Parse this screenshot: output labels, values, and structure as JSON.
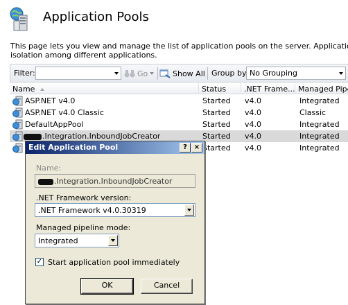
{
  "header": {
    "title": "Application Pools",
    "description_line1": "This page lets you view and manage the list of application pools on the server. Application pools are a",
    "description_line2": "isolation among different applications."
  },
  "toolbar": {
    "filter_label": "Filter:",
    "filter_value": "",
    "go_label": "Go",
    "show_all_label": "Show All",
    "group_by_label": "Group by:",
    "group_by_value": "No Grouping"
  },
  "list": {
    "columns": [
      "Name",
      "Status",
      ".NET Frame...",
      "Managed Pipel"
    ],
    "rows": [
      {
        "name": "ASP.NET v4.0",
        "status": "Started",
        "framework": "v4.0",
        "pipeline": "Integrated"
      },
      {
        "name": "ASP.NET v4.0 Classic",
        "status": "Started",
        "framework": "v4.0",
        "pipeline": "Classic"
      },
      {
        "name": "DefaultAppPool",
        "status": "Started",
        "framework": "v4.0",
        "pipeline": "Integrated"
      },
      {
        "name": ".Integration.InboundJobCreator",
        "status": "Started",
        "framework": "v4.0",
        "pipeline": "Integrated",
        "selected": true
      },
      {
        "name": "",
        "status": "Started",
        "framework": "v4.0",
        "pipeline": "Integrated"
      }
    ]
  },
  "dialog": {
    "title": "Edit Application Pool",
    "help_label": "?",
    "close_label": "×",
    "name_label": "Name:",
    "name_value": ".Integration.InboundJobCreator",
    "framework_label": ".NET Framework version:",
    "framework_value": ".NET Framework v4.0.30319",
    "pipeline_label": "Managed pipeline mode:",
    "pipeline_value": "Integrated",
    "start_label": "Start application pool immediately",
    "start_checked": true,
    "ok_label": "OK",
    "cancel_label": "Cancel"
  }
}
